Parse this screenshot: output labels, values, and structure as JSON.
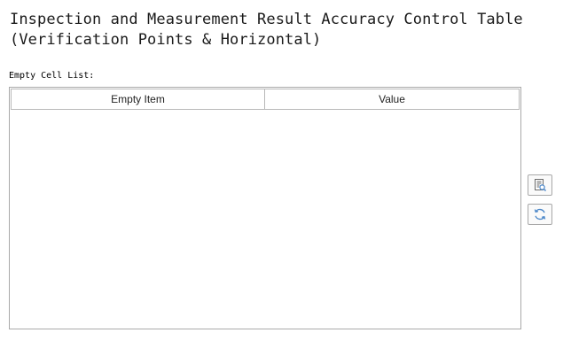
{
  "page": {
    "title_line1": "Inspection and Measurement Result Accuracy Control Table",
    "title_line2": "(Verification Points & Horizontal)"
  },
  "empty_cell_list": {
    "label": "Empty Cell List:",
    "columns": [
      "Empty Item",
      "Value"
    ],
    "rows": []
  },
  "toolbar": {
    "buttons": [
      {
        "icon": "document-preview-icon"
      },
      {
        "icon": "refresh-icon"
      }
    ]
  },
  "colors": {
    "icon_accent": "#4a86c8",
    "border": "#a9a9a9"
  }
}
